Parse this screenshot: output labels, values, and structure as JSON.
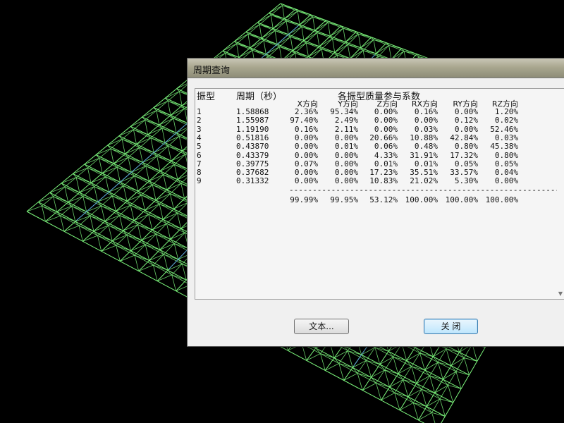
{
  "window": {
    "title": "周期查询"
  },
  "table": {
    "col_mode": "振型",
    "col_period": "周期（秒）",
    "col_group": "各振型质量参与系数",
    "sub_headers": [
      "X方向",
      "Y方向",
      "Z方向",
      "RX方向",
      "RY方向",
      "RZ方向"
    ],
    "rows": [
      {
        "mode": "1",
        "period": "1.58868",
        "vals": [
          "2.36%",
          "95.34%",
          "0.00%",
          "0.16%",
          "0.00%",
          "1.20%"
        ]
      },
      {
        "mode": "2",
        "period": "1.55987",
        "vals": [
          "97.40%",
          "2.49%",
          "0.00%",
          "0.00%",
          "0.12%",
          "0.02%"
        ]
      },
      {
        "mode": "3",
        "period": "1.19190",
        "vals": [
          "0.16%",
          "2.11%",
          "0.00%",
          "0.03%",
          "0.00%",
          "52.46%"
        ]
      },
      {
        "mode": "4",
        "period": "0.51816",
        "vals": [
          "0.00%",
          "0.00%",
          "20.66%",
          "10.88%",
          "42.84%",
          "0.03%"
        ]
      },
      {
        "mode": "5",
        "period": "0.43870",
        "vals": [
          "0.00%",
          "0.01%",
          "0.06%",
          "0.48%",
          "0.80%",
          "45.38%"
        ]
      },
      {
        "mode": "6",
        "period": "0.43379",
        "vals": [
          "0.00%",
          "0.00%",
          "4.33%",
          "31.91%",
          "17.32%",
          "0.80%"
        ]
      },
      {
        "mode": "7",
        "period": "0.39775",
        "vals": [
          "0.07%",
          "0.00%",
          "0.01%",
          "0.01%",
          "0.05%",
          "0.05%"
        ]
      },
      {
        "mode": "8",
        "period": "0.37682",
        "vals": [
          "0.00%",
          "0.00%",
          "17.23%",
          "35.51%",
          "33.57%",
          "0.04%"
        ]
      },
      {
        "mode": "9",
        "period": "0.31332",
        "vals": [
          "0.00%",
          "0.00%",
          "10.83%",
          "21.02%",
          "5.30%",
          "0.00%"
        ]
      }
    ],
    "separator": "----------------------------------------------------------",
    "totals": [
      "99.99%",
      "99.95%",
      "53.12%",
      "100.00%",
      "100.00%",
      "100.00%"
    ]
  },
  "buttons": {
    "text_label": "文本...",
    "close_label": "关  闭"
  },
  "icons": {
    "scroll_down": "scroll-down-arrow-icon"
  },
  "colors": {
    "mesh_green": "#7cf57c",
    "mesh_blue": "#4a7cff",
    "background": "#000000"
  }
}
